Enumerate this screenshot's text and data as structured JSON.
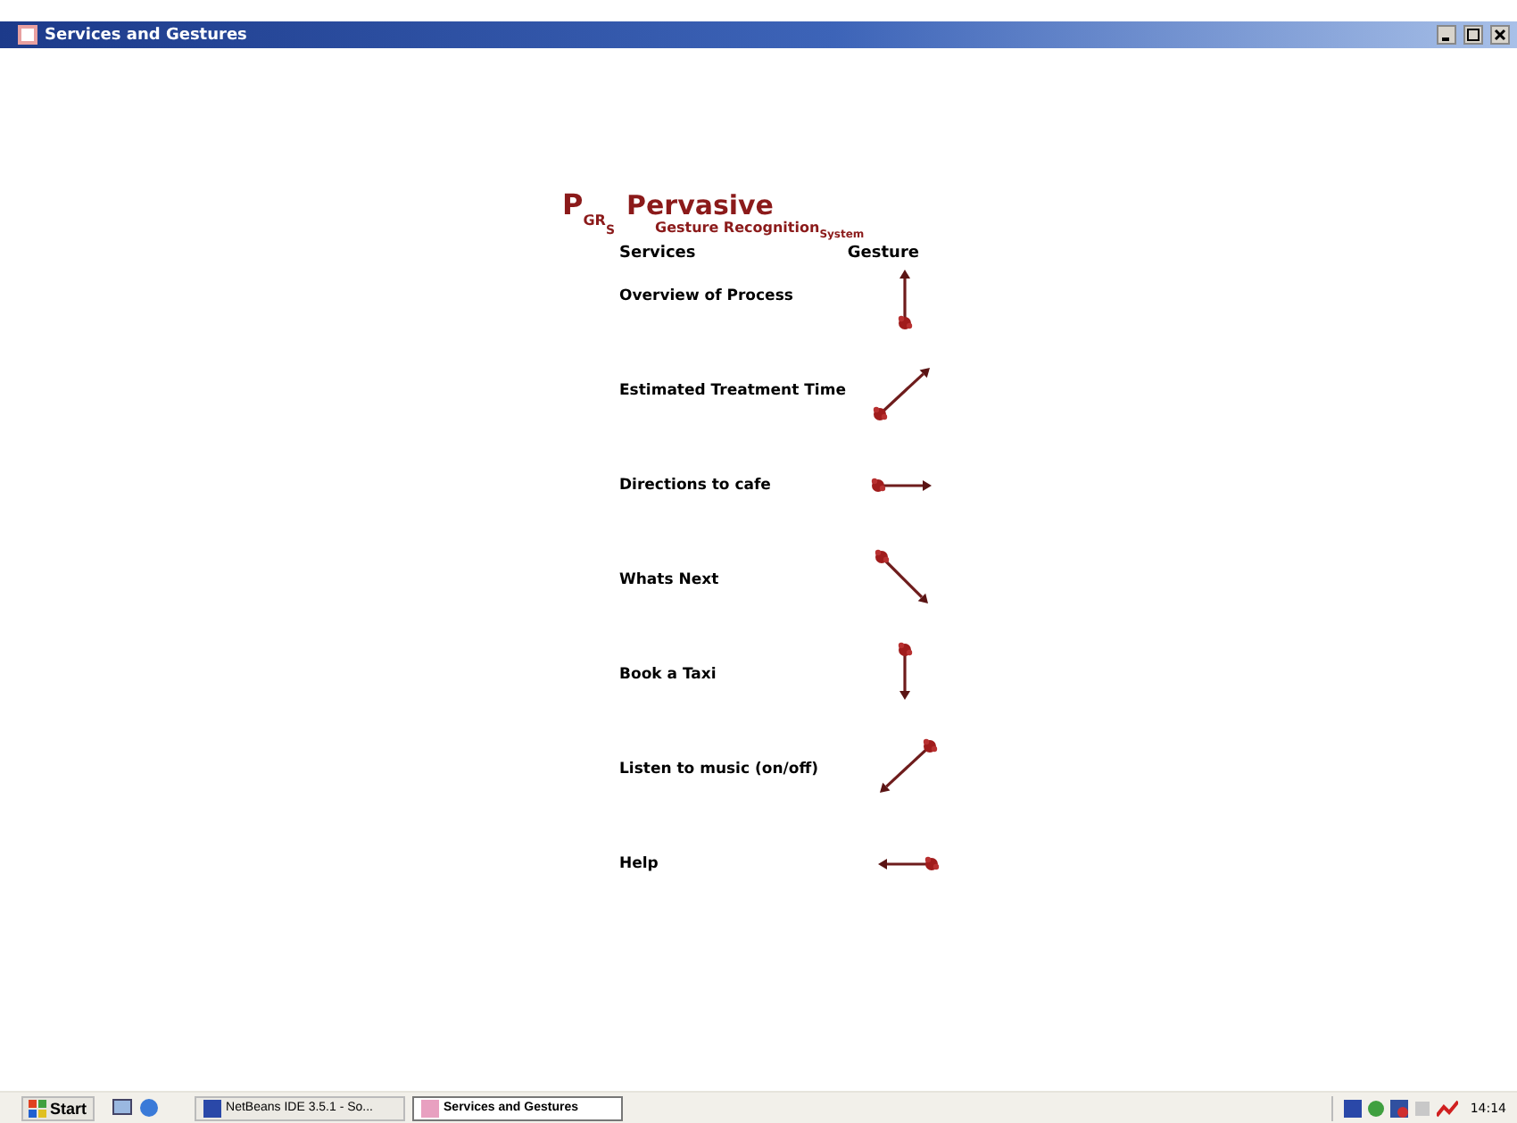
{
  "window": {
    "title": "Services and Gestures"
  },
  "logo": {
    "mark": "P",
    "mark_sub": "GR",
    "mark_sub2": "S",
    "name": "Pervasive",
    "subtitle": "Gesture Recognition",
    "subtitle_sub": "System"
  },
  "columns": [
    "Services",
    "Gesture"
  ],
  "services": [
    {
      "label": "Overview of Process",
      "kind": "up"
    },
    {
      "label": "Estimated Treatment Time",
      "kind": "upright"
    },
    {
      "label": "Directions to cafe",
      "kind": "right"
    },
    {
      "label": "Whats Next",
      "kind": "downright"
    },
    {
      "label": "Book a Taxi",
      "kind": "down"
    },
    {
      "label": "Listen to music (on/off)",
      "kind": "downleft"
    },
    {
      "label": "Help",
      "kind": "left"
    }
  ],
  "taskbar": {
    "start": "Start",
    "tasks": [
      {
        "label": "NetBeans IDE 3.5.1 - So...",
        "selected": false
      },
      {
        "label": "Services and Gestures",
        "selected": true
      }
    ],
    "clock": "14:14"
  }
}
